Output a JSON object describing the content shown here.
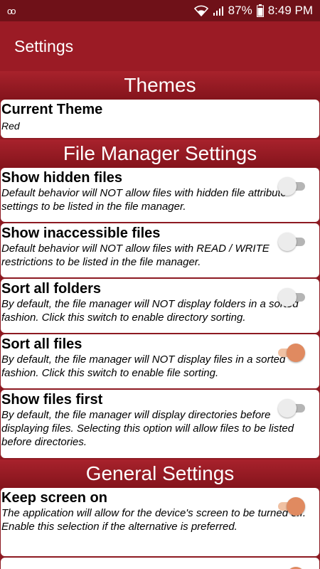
{
  "status_bar": {
    "battery": "87%",
    "time": "8:49 PM",
    "icons": [
      "voicemail-icon",
      "wifi-icon",
      "signal-icon",
      "battery-icon"
    ]
  },
  "app_bar": {
    "title": "Settings"
  },
  "sections": {
    "themes": {
      "header": "Themes",
      "current_theme": {
        "title": "Current Theme",
        "value": "Red"
      }
    },
    "file_manager": {
      "header": "File Manager Settings",
      "items": [
        {
          "title": "Show hidden files",
          "desc": "Default behavior will NOT allow files with hidden file attribute settings to be listed in the file manager.",
          "enabled": false
        },
        {
          "title": "Show inaccessible files",
          "desc": "Default behavior will NOT allow files with READ / WRITE restrictions to be listed in the file manager.",
          "enabled": false
        },
        {
          "title": "Sort all folders",
          "desc": "By default, the file manager will NOT display folders in a sorted fashion. Click this switch to enable directory sorting.",
          "enabled": false
        },
        {
          "title": "Sort all files",
          "desc": "By default, the file manager will NOT display files in a sorted fashion. Click this switch to enable file sorting.",
          "enabled": true
        },
        {
          "title": "Show files first",
          "desc": "By default, the file manager will display directories before displaying files. Selecting this option will allow files to be listed before directories.",
          "enabled": false
        }
      ]
    },
    "general": {
      "header": "General Settings",
      "items": [
        {
          "title": "Keep screen on",
          "desc": "The application will allow for the device's screen to be turned off. Enable this selection if the alternative is preferred.",
          "enabled": true
        }
      ]
    }
  },
  "colors": {
    "status_bar": "#6f1118",
    "app_bar": "#9b1b25",
    "section_header": "#a8222c",
    "toggle_on": "#e08a60",
    "toggle_off": "#ececec"
  }
}
